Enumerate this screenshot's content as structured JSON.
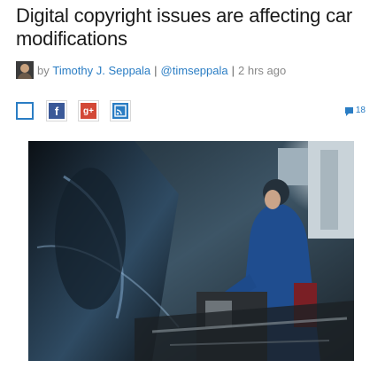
{
  "article": {
    "title": "Digital copyright issues are affecting car modifications",
    "byline_prefix": "by",
    "author_name": "Timothy J. Seppala",
    "author_handle": "@timseppala",
    "separator": "|",
    "timestamp": "2 hrs ago",
    "comment_count": "18"
  },
  "share": {
    "icons": [
      "bookmark-icon",
      "facebook-icon",
      "google-plus-icon",
      "rss-icon"
    ],
    "fb_glyph": "f",
    "gp_glyph": "g+"
  },
  "colors": {
    "link": "#2a7dc4",
    "facebook": "#3b5998",
    "google_plus": "#d34836"
  },
  "image": {
    "description_icon": "mechanic-car-engine-photo"
  }
}
